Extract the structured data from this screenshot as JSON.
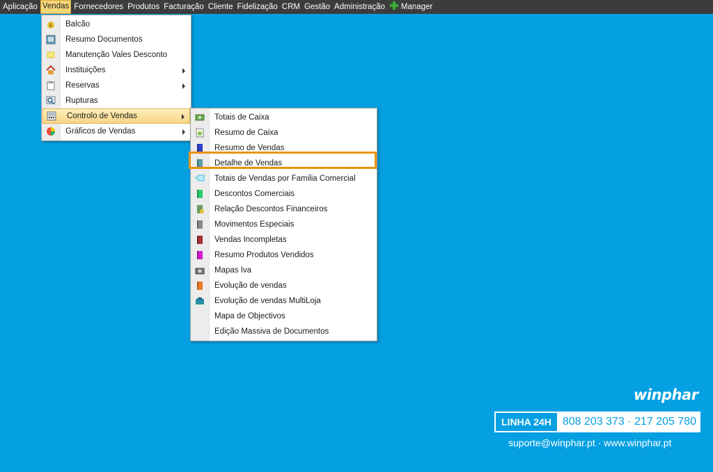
{
  "menubar": {
    "items": [
      "Aplicação",
      "Vendas",
      "Fornecedores",
      "Produtos",
      "Facturação",
      "Cliente",
      "Fidelização",
      "CRM",
      "Gestão",
      "Administração"
    ],
    "manager": "Manager",
    "active": "Vendas"
  },
  "vendas_menu": {
    "items": [
      {
        "label": "Balcão",
        "icon": "money-bag-icon",
        "submenu": false
      },
      {
        "label": "Resumo Documentos",
        "icon": "document-summary-icon",
        "submenu": false
      },
      {
        "label": "Manutenção Vales Desconto",
        "icon": "voucher-icon",
        "submenu": false
      },
      {
        "label": "Instituições",
        "icon": "house-icon",
        "submenu": true
      },
      {
        "label": "Reservas",
        "icon": "clipboard-icon",
        "submenu": true
      },
      {
        "label": "Rupturas",
        "icon": "magnifier-icon",
        "submenu": false
      },
      {
        "label": "Controlo de Vendas",
        "icon": "calculator-icon",
        "submenu": true,
        "highlighted": true
      },
      {
        "label": "Gráficos de Vendas",
        "icon": "pie-chart-icon",
        "submenu": true
      }
    ]
  },
  "controlo_menu": {
    "items": [
      {
        "label": "Totais de Caixa",
        "icon": "cash-total-icon",
        "color": "#6aa84f"
      },
      {
        "label": "Resumo de Caixa",
        "icon": "cash-summary-icon",
        "color": "#8bc34a"
      },
      {
        "label": "Resumo de Vendas",
        "icon": "book-blue-icon",
        "color": "#2e3fc8"
      },
      {
        "label": "Detalhe de Vendas",
        "icon": "book-teal-icon",
        "color": "#5b9aa8"
      },
      {
        "label": "Totais de Vendas por Familia Comercial",
        "icon": "tag-icon",
        "color": "#38c0e0"
      },
      {
        "label": "Descontos Comerciais",
        "icon": "book-green-icon",
        "color": "#2ecc71"
      },
      {
        "label": "Relação Descontos Financeiros",
        "icon": "book-finance-icon",
        "color": "#6e9a5a"
      },
      {
        "label": "Movimentos Especiais",
        "icon": "book-gray-icon",
        "color": "#8a8a8a"
      },
      {
        "label": "Vendas Incompletas",
        "icon": "book-red-icon",
        "color": "#a83232"
      },
      {
        "label": "Resumo Produtos Vendidos",
        "icon": "book-magenta-icon",
        "color": "#d61ed1"
      },
      {
        "label": "Mapas Iva",
        "icon": "projector-icon",
        "color": "#555555"
      },
      {
        "label": "Evolução de vendas",
        "icon": "book-orange-icon",
        "color": "#f07b28"
      },
      {
        "label": "Evolução de vendas MultiLoja",
        "icon": "multistore-icon",
        "color": "#2a8fa8"
      },
      {
        "label": "Mapa de Objectivos",
        "icon": "",
        "color": ""
      },
      {
        "label": "Edição Massiva de Documentos",
        "icon": "",
        "color": ""
      }
    ],
    "focused": "Detalhe de Vendas"
  },
  "branding": {
    "logo": "winphar",
    "linha_label": "LINHA 24H",
    "phones": "808 203 373 · 217 205 780",
    "contacts": "suporte@winphar.pt  ·  www.winphar.pt"
  }
}
